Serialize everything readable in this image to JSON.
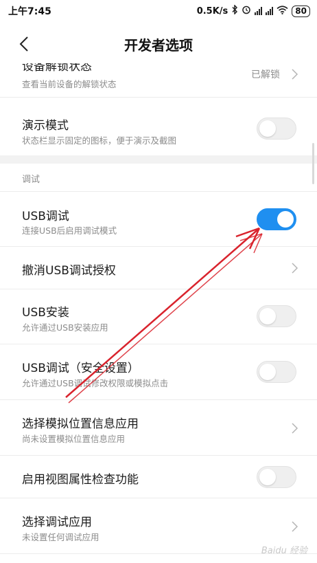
{
  "status_bar": {
    "time": "上午7:45",
    "speed": "0.5K/s",
    "battery": "80"
  },
  "header": {
    "title": "开发者选项"
  },
  "items": {
    "unlock": {
      "title": "设备解锁状态",
      "sub": "查看当前设备的解锁状态",
      "value": "已解锁"
    },
    "demo": {
      "title": "演示模式",
      "sub": "状态栏显示固定的图标，便于演示及截图",
      "enabled": false
    },
    "usb_debug": {
      "title": "USB调试",
      "sub": "连接USB后启用调试模式",
      "enabled": true
    },
    "revoke": {
      "title": "撤消USB调试授权"
    },
    "usb_install": {
      "title": "USB安装",
      "sub": "允许通过USB安装应用",
      "enabled": false
    },
    "usb_debug_secure": {
      "title": "USB调试（安全设置）",
      "sub": "允许通过USB调试修改权限或模拟点击",
      "enabled": false
    },
    "mock_location": {
      "title": "选择模拟位置信息应用",
      "sub": "尚未设置模拟位置信息应用"
    },
    "view_attr": {
      "title": "启用视图属性检查功能",
      "enabled": false
    },
    "debug_app": {
      "title": "选择调试应用",
      "sub": "未设置任何调试应用"
    }
  },
  "section": {
    "debug_header": "调试"
  },
  "watermark": "Baidu 经验",
  "colors": {
    "accent": "#1f8ff0",
    "annotation": "#d9232d"
  }
}
